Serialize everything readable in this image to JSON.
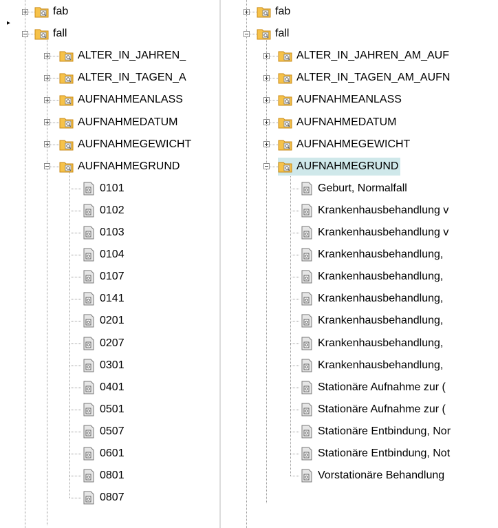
{
  "left_tree": {
    "top_nodes": [
      "fab",
      "fall"
    ],
    "fall_children": [
      "ALTER_IN_JAHREN_",
      "ALTER_IN_TAGEN_A",
      "AUFNAHMEANLASS",
      "AUFNAHMEDATUM",
      "AUFNAHMEGEWICHT",
      "AUFNAHMEGRUND"
    ],
    "grund_values": [
      "0101",
      "0102",
      "0103",
      "0104",
      "0107",
      "0141",
      "0201",
      "0207",
      "0301",
      "0401",
      "0501",
      "0507",
      "0601",
      "0801",
      "0807"
    ]
  },
  "right_tree": {
    "top_nodes": [
      "fab",
      "fall"
    ],
    "fall_children": [
      "ALTER_IN_JAHREN_AM_AUF",
      "ALTER_IN_TAGEN_AM_AUFN",
      "AUFNAHMEANLASS",
      "AUFNAHMEDATUM",
      "AUFNAHMEGEWICHT",
      "AUFNAHMEGRUND"
    ],
    "selected_node": "AUFNAHMEGRUND",
    "grund_values": [
      "Geburt, Normalfall",
      "Krankenhausbehandlung v",
      "Krankenhausbehandlung v",
      "Krankenhausbehandlung,",
      "Krankenhausbehandlung,",
      "Krankenhausbehandlung,",
      "Krankenhausbehandlung,",
      "Krankenhausbehandlung,",
      "Krankenhausbehandlung,",
      "Stationäre Aufnahme zur (",
      "Stationäre Aufnahme zur (",
      "Stationäre Entbindung, Nor",
      "Stationäre Entbindung, Not",
      "Vorstationäre Behandlung"
    ]
  },
  "colors": {
    "selection_background": "#cfe8ea",
    "folder_fill": "#f6c24a",
    "folder_edge": "#c98a14",
    "doc_fill": "#e6e6e6",
    "doc_badge": "#555555",
    "tree_lines": "#9a9a9a",
    "pane_divider": "#dcdcdc"
  },
  "icons": {
    "category": "folder-icon",
    "value": "document-icon",
    "expand": "plus-box-icon",
    "collapse": "minus-box-icon"
  }
}
